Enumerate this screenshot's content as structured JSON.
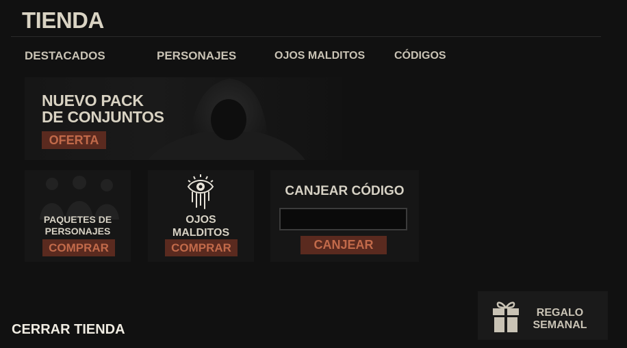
{
  "header": {
    "title": "TIENDA"
  },
  "tabs": [
    {
      "label": "DESTACADOS"
    },
    {
      "label": "PERSONAJES"
    },
    {
      "label": "OJOS MALDITOS"
    },
    {
      "label": "CÓDIGOS"
    }
  ],
  "banner": {
    "title_line1": "NUEVO PACK",
    "title_line2": "DE CONJUNTOS",
    "button": "OFERTA"
  },
  "cards": {
    "characters": {
      "line1": "PAQUETES DE",
      "line2": "PERSONAJES",
      "button": "COMPRAR"
    },
    "cursed_eyes": {
      "line1": "OJOS",
      "line2": "MALDITOS",
      "button": "COMPRAR",
      "icon": "cursed-eye-icon"
    },
    "redeem": {
      "title": "CANJEAR CÓDIGO",
      "input_value": "",
      "input_placeholder": "",
      "button": "CANJEAR"
    }
  },
  "footer": {
    "close": "CERRAR TIENDA",
    "weekly_gift_line1": "REGALO",
    "weekly_gift_line2": "SEMANAL",
    "icon": "gift-icon"
  },
  "colors": {
    "background": "#111111",
    "button_bg": "#5a2a1f",
    "button_text": "#c26a4a",
    "text": "#d6d1c4"
  }
}
